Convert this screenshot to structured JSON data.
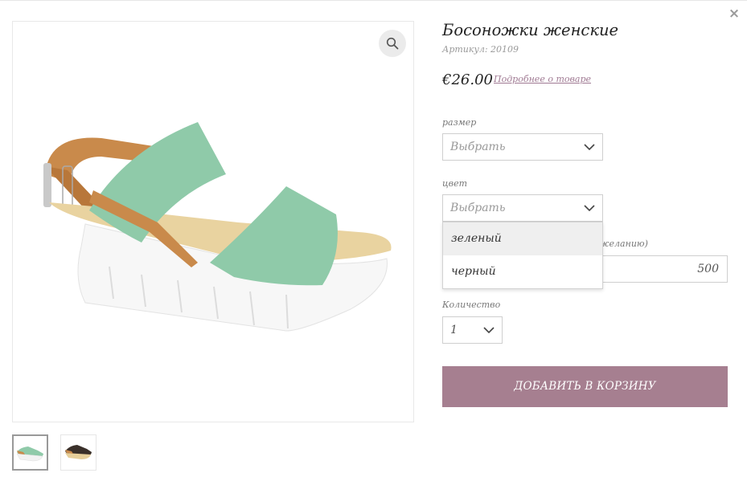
{
  "modal": {
    "close_label": "×"
  },
  "gallery": {
    "zoom_icon": "search-icon",
    "thumbnails": [
      {
        "icon": "green-sandal-thumbnail",
        "active": true
      },
      {
        "icon": "black-sandal-thumbnail",
        "active": false
      }
    ]
  },
  "product": {
    "title": "Босоножки женские",
    "sku": "Артикул: 20109",
    "price": "€26.00",
    "details_link": "Подробнее о товаре"
  },
  "options": {
    "size": {
      "label": "размер",
      "value": "Выбрать"
    },
    "color": {
      "label": "цвет",
      "value": "Выбрать",
      "options": [
        "зеленый",
        "черный"
      ]
    },
    "amount": {
      "label_tail": "желанию)",
      "value": "500"
    },
    "quantity": {
      "label": "Количество",
      "value": "1"
    }
  },
  "cart": {
    "add_label": "ДОБАВИТЬ В КОРЗИНУ"
  },
  "colors": {
    "accent": "#a67f90",
    "link": "#a07a93",
    "strap_green": "#8fcaa9",
    "leather": "#c98a4b",
    "sole": "#ffffff"
  }
}
